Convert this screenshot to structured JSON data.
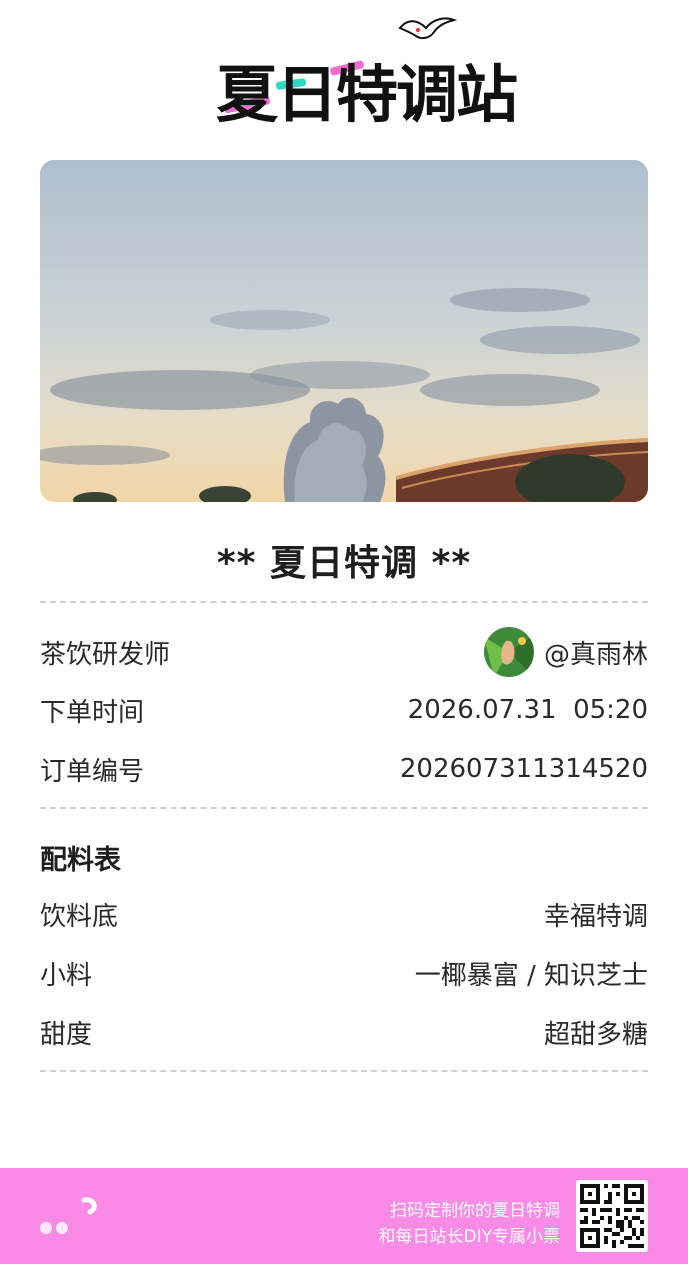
{
  "header": {
    "logo_text": "夏日特调站",
    "bird_icon": "seagull-icon"
  },
  "photo": {
    "description_icon": "sunset-sky-photo"
  },
  "receipt": {
    "title": "** 夏日特调 **",
    "info_rows": [
      {
        "label": "茶饮研发师",
        "value": "@真雨林"
      },
      {
        "label": "下单时间",
        "value": "2026.07.31  05:20"
      },
      {
        "label": "订单编号",
        "value": "202607311314520"
      }
    ],
    "ingredients_title": "配料表",
    "ingredients": [
      {
        "label": "饮料底",
        "value": "幸福特调"
      },
      {
        "label": "小料",
        "value": "一椰暴富 / 知识芝士"
      },
      {
        "label": "甜度",
        "value": "超甜多糖"
      }
    ]
  },
  "footer": {
    "line1": "扫码定制你的夏日特调",
    "line2": "和每日站长DIY专属小票",
    "background": "#f98ae6"
  },
  "colors": {
    "accent_pink": "#f36cd4",
    "accent_teal": "#31d7c3"
  }
}
